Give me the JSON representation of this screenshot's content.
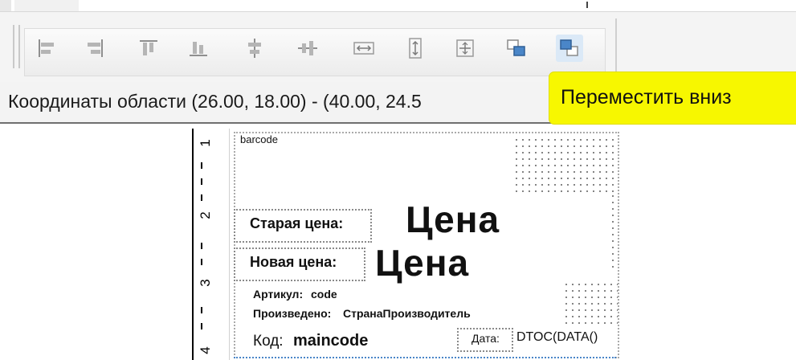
{
  "toolbar": {
    "buttons": [
      {
        "name": "align-left-icon"
      },
      {
        "name": "align-right-icon"
      },
      {
        "name": "align-top-icon"
      },
      {
        "name": "align-bottom-icon"
      },
      {
        "name": "align-center-vertical-icon"
      },
      {
        "name": "align-center-horizontal-icon"
      },
      {
        "name": "equal-width-icon"
      },
      {
        "name": "equal-height-icon"
      },
      {
        "name": "move-center-icon"
      },
      {
        "name": "bring-to-front-icon"
      },
      {
        "name": "send-to-back-icon"
      }
    ]
  },
  "status": {
    "coordinates_text": "Координаты области (26.00, 18.00) - (40.00, 24.5"
  },
  "tooltip": {
    "text": "Переместить вниз"
  },
  "ruler": {
    "labels": [
      "1",
      "2",
      "3",
      "4"
    ]
  },
  "report": {
    "barcode_label": "barcode",
    "old_price_label": "Старая цена:",
    "old_price_value": "Цена",
    "new_price_label": "Новая цена:",
    "new_price_value": "Цена",
    "article_label": "Артикул:",
    "article_value": "code",
    "produced_label": "Произведено:",
    "produced_value": "СтранаПроизводитель",
    "code_label": "Код:",
    "code_value": "maincode",
    "date_label": "Дата:",
    "date_value": "DTOC(DATA()"
  },
  "colors": {
    "tooltip_bg": "#f7f700",
    "selection_blue": "#4a86c8"
  }
}
